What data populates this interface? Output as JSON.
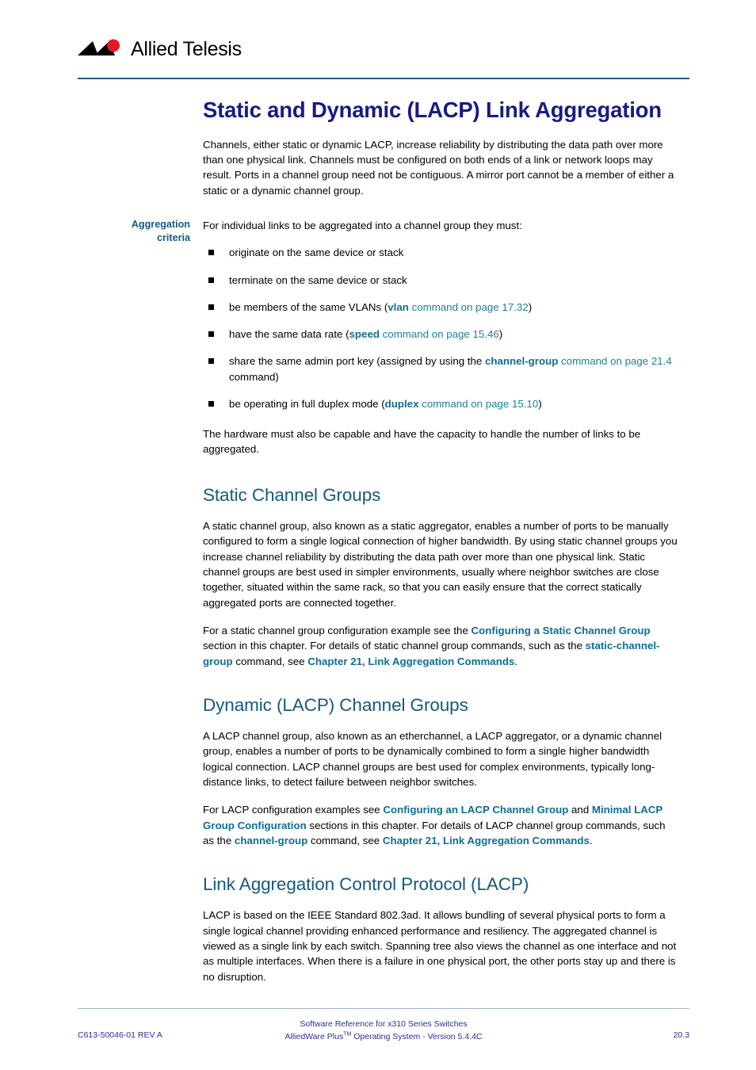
{
  "header": {
    "logo_name": "allied-telesis-logo",
    "logo_text": "Allied Telesis",
    "accent_color": "#1a5f86",
    "logo_red": "#e01b24"
  },
  "title": "Static and Dynamic (LACP) Link Aggregation",
  "intro": "Channels, either static or dynamic LACP, increase reliability by distributing the data path over more than one physical link. Channels must be configured on both ends of a link or network loops may result. Ports in a channel group need not be contiguous. A mirror port cannot be a member of either a static or a dynamic channel group.",
  "criteria": {
    "margin_note_line1": "Aggregation",
    "margin_note_line2": "criteria",
    "lead": "For individual links to be aggregated into a channel group they must:",
    "items": [
      {
        "text": "originate on the same device or stack"
      },
      {
        "text": "terminate on the same device or stack"
      },
      {
        "pre": "be members of the same VLANs (",
        "cmd": "vlan",
        "link": " command on page 17.32",
        "post": ")"
      },
      {
        "pre": "have the same data rate (",
        "cmd": "speed",
        "link": " command on page 15.46",
        "post": ")"
      },
      {
        "pre": "share the same admin port key (assigned by using the ",
        "cmd": "channel-group",
        "link": " command on page 21.4",
        "post": " command)"
      },
      {
        "pre": "be operating in full duplex mode (",
        "cmd": "duplex",
        "link": " command on page 15.10",
        "post": ")"
      }
    ],
    "closing": "The hardware must also be capable and have the capacity to handle the number of links to be aggregated."
  },
  "sections": [
    {
      "heading": "Static Channel Groups",
      "para1": "A static channel group, also known as a static aggregator, enables a number of ports to be manually configured to form a single logical connection of higher bandwidth. By using static channel groups you increase channel reliability by distributing the data path over more than one physical link. Static channel groups are best used in simpler environments, usually where neighbor switches are close together, situated within the same rack, so that you can easily ensure that the correct statically aggregated ports are connected together.",
      "para2": {
        "t1": "For a static channel group configuration example see the ",
        "link1": "Configuring a Static Channel Group",
        "t2": " section in this chapter. For details of static channel group commands, such as the ",
        "link2": "static-channel-group",
        "t3": " command, see ",
        "link3": "Chapter 21, Link Aggregation Commands",
        "t4": "."
      }
    },
    {
      "heading": "Dynamic (LACP) Channel Groups",
      "para1": "A LACP channel group, also known as an etherchannel, a LACP aggregator, or a dynamic channel group, enables a number of ports to be dynamically combined to form a single higher bandwidth logical connection. LACP channel groups are best used for complex environments, typically long-distance links, to detect failure between neighbor switches.",
      "para2": {
        "t1": "For LACP configuration examples see ",
        "link1": "Configuring an LACP Channel Group",
        "t2": " and ",
        "link2": "Minimal LACP Group Configuration",
        "t3": " sections in this chapter. For details of LACP channel group commands, such as the ",
        "link3": "channel-group",
        "t4": " command, see ",
        "link4": "Chapter 21, Link Aggregation Commands",
        "t5": "."
      }
    },
    {
      "heading": "Link Aggregation Control Protocol (LACP)",
      "para1": "LACP is based on the IEEE Standard 802.3ad. It allows bundling of several physical ports to form a single logical channel providing enhanced performance and resiliency. The aggregated channel is viewed as a single link by each switch. Spanning tree also views the channel as one interface and not as multiple interfaces. When there is a failure in one physical port, the other ports stay up and there is no disruption."
    }
  ],
  "footer": {
    "center_line1": "Software Reference for x310 Series Switches",
    "center_line2_pre": "AlliedWare Plus",
    "center_line2_tm": "TM",
    "center_line2_post": " Operating System - Version 5.4.4C",
    "left": "C613-50046-01 REV A",
    "right": "20.3",
    "color": "#2b2f96"
  }
}
